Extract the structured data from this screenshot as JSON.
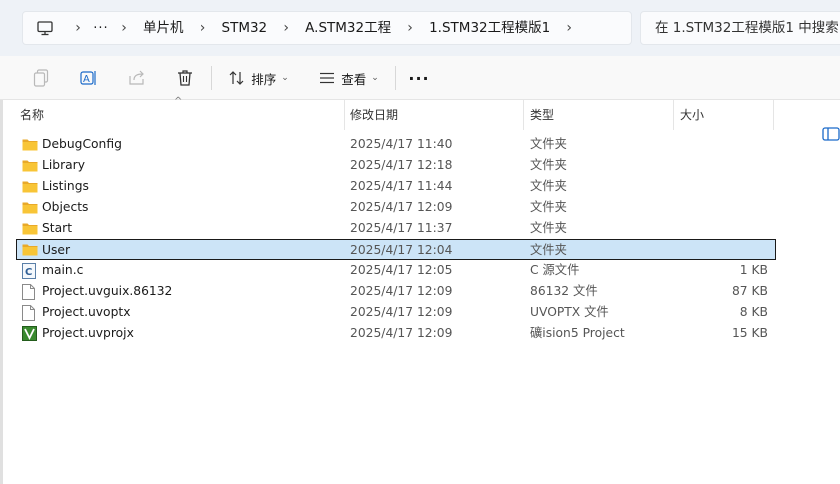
{
  "breadcrumb": {
    "items": [
      "单片机",
      "STM32",
      "A.STM32工程",
      "1.STM32工程模版1"
    ],
    "ellipsis": "···"
  },
  "search": {
    "placeholder": "在 1.STM32工程模版1 中搜索"
  },
  "toolbar": {
    "sort_label": "排序",
    "view_label": "查看",
    "more_label": "···"
  },
  "columns": {
    "name": "名称",
    "date": "修改日期",
    "type": "类型",
    "size": "大小"
  },
  "files": [
    {
      "name": "DebugConfig",
      "date": "2025/4/17 11:40",
      "type": "文件夹",
      "size": "",
      "icon": "folder-icon"
    },
    {
      "name": "Library",
      "date": "2025/4/17 12:18",
      "type": "文件夹",
      "size": "",
      "icon": "folder-icon"
    },
    {
      "name": "Listings",
      "date": "2025/4/17 11:44",
      "type": "文件夹",
      "size": "",
      "icon": "folder-icon"
    },
    {
      "name": "Objects",
      "date": "2025/4/17 12:09",
      "type": "文件夹",
      "size": "",
      "icon": "folder-icon"
    },
    {
      "name": "Start",
      "date": "2025/4/17 11:37",
      "type": "文件夹",
      "size": "",
      "icon": "folder-icon"
    },
    {
      "name": "User",
      "date": "2025/4/17 12:04",
      "type": "文件夹",
      "size": "",
      "icon": "folder-icon",
      "selected": true
    },
    {
      "name": "main.c",
      "date": "2025/4/17 12:05",
      "type": "C 源文件",
      "size": "1 KB",
      "icon": "c-file-icon"
    },
    {
      "name": "Project.uvguix.86132",
      "date": "2025/4/17 12:09",
      "type": "86132 文件",
      "size": "87 KB",
      "icon": "file-icon"
    },
    {
      "name": "Project.uvoptx",
      "date": "2025/4/17 12:09",
      "type": "UVOPTX 文件",
      "size": "8 KB",
      "icon": "file-icon"
    },
    {
      "name": "Project.uvprojx",
      "date": "2025/4/17 12:09",
      "type": "礦ision5 Project",
      "size": "15 KB",
      "icon": "keil-project-icon"
    }
  ],
  "colors": {
    "folder": "#f8c537",
    "selection_bg": "#cce4f7",
    "keil_green": "#3a8a2f"
  }
}
